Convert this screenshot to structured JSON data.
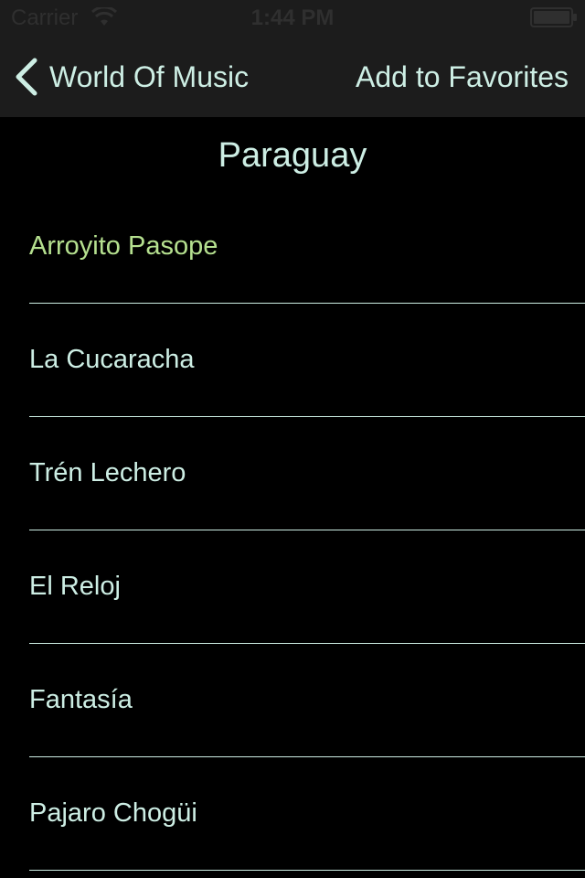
{
  "status_bar": {
    "carrier": "Carrier",
    "time": "1:44 PM",
    "wifi_icon": "wifi-icon",
    "battery_icon": "battery-icon"
  },
  "nav": {
    "back_label": "World Of Music",
    "back_icon": "chevron-left-icon",
    "favorites_label": "Add to Favorites"
  },
  "page": {
    "title": "Paraguay"
  },
  "songs": [
    {
      "title": "Arroyito Pasope",
      "selected": true
    },
    {
      "title": "La Cucaracha",
      "selected": false
    },
    {
      "title": "Trén Lechero",
      "selected": false
    },
    {
      "title": "El Reloj",
      "selected": false
    },
    {
      "title": "Fantasía",
      "selected": false
    },
    {
      "title": "Pajaro Chogüi",
      "selected": false
    }
  ],
  "colors": {
    "background": "#000000",
    "bar_background": "#1c1c1c",
    "text": "#cdeee4",
    "selected_text": "#b5e08f",
    "status_text": "#2f2f2f"
  }
}
